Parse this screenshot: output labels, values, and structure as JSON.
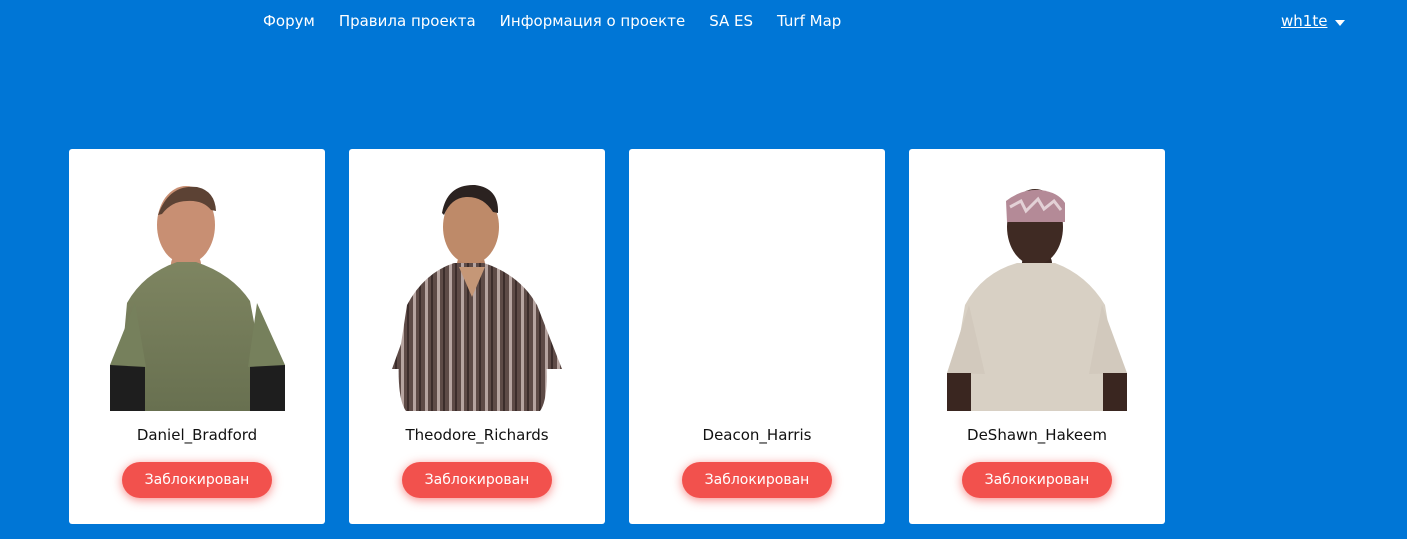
{
  "nav": {
    "forum": "Форум",
    "rules": "Правила проекта",
    "info": "Информация о проекте",
    "saes": "SA ES",
    "turfmap": "Turf Map"
  },
  "user": {
    "name": "wh1te"
  },
  "characters": [
    {
      "name": "Daniel_Bradford",
      "status": "Заблокирован",
      "avatar": "character-avatar"
    },
    {
      "name": "Theodore_Richards",
      "status": "Заблокирован",
      "avatar": "character-avatar"
    },
    {
      "name": "Deacon_Harris",
      "status": "Заблокирован",
      "avatar": ""
    },
    {
      "name": "DeShawn_Hakeem",
      "status": "Заблокирован",
      "avatar": "character-avatar"
    }
  ],
  "colors": {
    "background": "#0076d6",
    "status_button": "#f2514d",
    "card": "#ffffff"
  }
}
